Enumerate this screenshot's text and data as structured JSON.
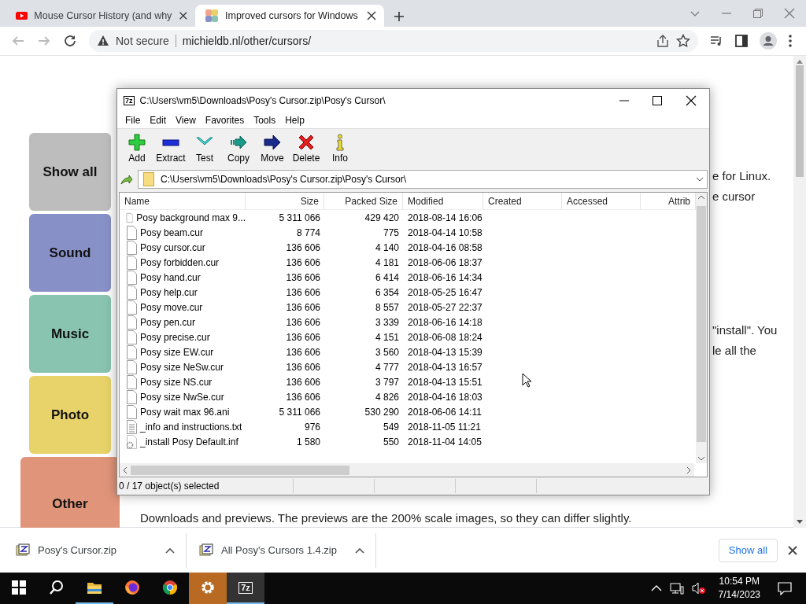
{
  "browser": {
    "tabs": [
      {
        "title": "Mouse Cursor History (and why",
        "kind": "video",
        "selected": false
      },
      {
        "title": "Improved cursors for Windows",
        "kind": "palette",
        "selected": true
      }
    ],
    "security": "Not secure",
    "url": "michieldb.nl/other/cursors/"
  },
  "page": {
    "nav": [
      {
        "label": "Show all",
        "color": "#bdbdbd",
        "selected": false
      },
      {
        "label": "Sound",
        "color": "#8890c8",
        "selected": false
      },
      {
        "label": "Music",
        "color": "#88c4b0",
        "selected": false
      },
      {
        "label": "Photo",
        "color": "#e8d36a",
        "selected": false
      },
      {
        "label": "Other",
        "color": "#e0957a",
        "selected": true
      }
    ],
    "side_text": [
      [
        "e for Linux.",
        "e cursor"
      ],
      [
        "\"install\". You",
        "le all the"
      ]
    ],
    "note": "Downloads and previews. The previews are the 200% scale images, so they can differ slightly."
  },
  "archive_window": {
    "app_icon": "7z",
    "title": "C:\\Users\\vm5\\Downloads\\Posy's Cursor.zip\\Posy's Cursor\\",
    "menu": [
      "File",
      "Edit",
      "View",
      "Favorites",
      "Tools",
      "Help"
    ],
    "toolbar": [
      {
        "label": "Add",
        "kind": "add"
      },
      {
        "label": "Extract",
        "kind": "extract"
      },
      {
        "label": "Test",
        "kind": "test"
      },
      {
        "label": "Copy",
        "kind": "copy"
      },
      {
        "label": "Move",
        "kind": "move"
      },
      {
        "label": "Delete",
        "kind": "delete"
      },
      {
        "label": "Info",
        "kind": "info"
      }
    ],
    "path": "C:\\Users\\vm5\\Downloads\\Posy's Cursor.zip\\Posy's Cursor\\",
    "columns": [
      "Name",
      "Size",
      "Packed Size",
      "Modified",
      "Created",
      "Accessed",
      "Attrib"
    ],
    "rows": [
      {
        "name": "Posy background max 9...",
        "size": "5 311 066",
        "packed": "429 420",
        "modified": "2018-08-14 16:06",
        "kind": "file"
      },
      {
        "name": "Posy beam.cur",
        "size": "8 774",
        "packed": "775",
        "modified": "2018-04-14 10:58",
        "kind": "file"
      },
      {
        "name": "Posy cursor.cur",
        "size": "136 606",
        "packed": "4 140",
        "modified": "2018-04-16 08:58",
        "kind": "file"
      },
      {
        "name": "Posy forbidden.cur",
        "size": "136 606",
        "packed": "4 181",
        "modified": "2018-06-06 18:37",
        "kind": "file"
      },
      {
        "name": "Posy hand.cur",
        "size": "136 606",
        "packed": "6 414",
        "modified": "2018-06-16 14:34",
        "kind": "file"
      },
      {
        "name": "Posy help.cur",
        "size": "136 606",
        "packed": "6 354",
        "modified": "2018-05-25 16:47",
        "kind": "file"
      },
      {
        "name": "Posy move.cur",
        "size": "136 606",
        "packed": "8 557",
        "modified": "2018-05-27 22:37",
        "kind": "file"
      },
      {
        "name": "Posy pen.cur",
        "size": "136 606",
        "packed": "3 339",
        "modified": "2018-06-16 14:18",
        "kind": "file"
      },
      {
        "name": "Posy precise.cur",
        "size": "136 606",
        "packed": "4 151",
        "modified": "2018-06-08 18:24",
        "kind": "file"
      },
      {
        "name": "Posy size EW.cur",
        "size": "136 606",
        "packed": "3 560",
        "modified": "2018-04-13 15:39",
        "kind": "file"
      },
      {
        "name": "Posy size NeSw.cur",
        "size": "136 606",
        "packed": "4 777",
        "modified": "2018-04-13 16:57",
        "kind": "file"
      },
      {
        "name": "Posy size NS.cur",
        "size": "136 606",
        "packed": "3 797",
        "modified": "2018-04-13 15:51",
        "kind": "file"
      },
      {
        "name": "Posy size NwSe.cur",
        "size": "136 606",
        "packed": "4 826",
        "modified": "2018-04-16 18:03",
        "kind": "file"
      },
      {
        "name": "Posy wait max 96.ani",
        "size": "5 311 066",
        "packed": "530 290",
        "modified": "2018-06-06 14:11",
        "kind": "file"
      },
      {
        "name": "_info and instructions.txt",
        "size": "976",
        "packed": "549",
        "modified": "2018-11-05 11:21",
        "kind": "text"
      },
      {
        "name": "_install Posy Default.inf",
        "size": "1 580",
        "packed": "550",
        "modified": "2018-11-04 14:05",
        "kind": "config"
      }
    ],
    "status": "0 / 17 object(s) selected"
  },
  "downloads": {
    "items": [
      "Posy's Cursor.zip",
      "All Posy's Cursors 1.4.zip"
    ],
    "show_all": "Show all"
  },
  "taskbar": {
    "apps": [
      {
        "kind": "start",
        "open": false,
        "highlighted": false,
        "selected": false
      },
      {
        "kind": "search",
        "open": false,
        "highlighted": false,
        "selected": false
      },
      {
        "kind": "explorer",
        "open": true,
        "highlighted": false,
        "selected": false
      },
      {
        "kind": "firefox",
        "open": false,
        "highlighted": false,
        "selected": false
      },
      {
        "kind": "chrome",
        "open": false,
        "highlighted": false,
        "selected": false
      },
      {
        "kind": "settings",
        "open": false,
        "highlighted": true,
        "selected": false
      },
      {
        "kind": "archiver",
        "label": "7z",
        "open": true,
        "highlighted": false,
        "selected": true
      }
    ],
    "time": "10:54 PM",
    "date": "7/14/2023"
  }
}
